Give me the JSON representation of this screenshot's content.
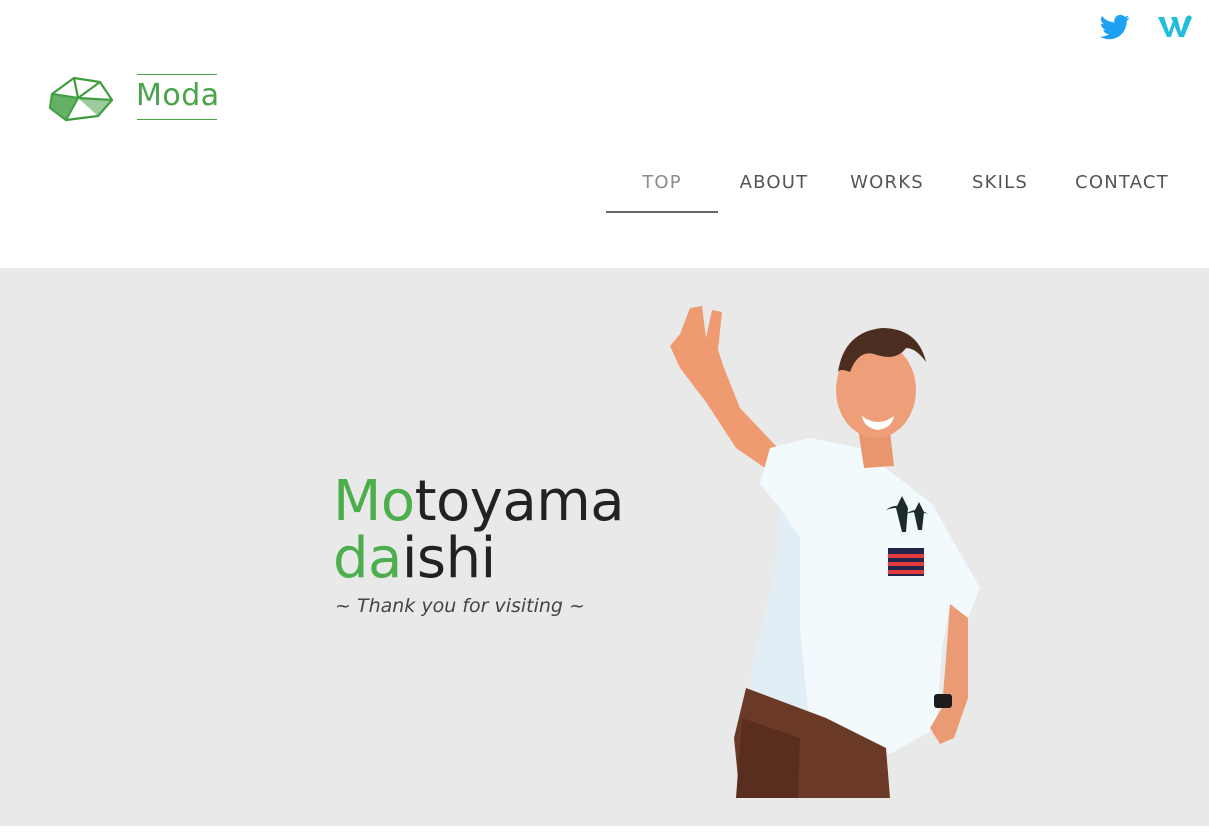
{
  "header": {
    "logo": {
      "text": "Moda"
    },
    "social": [
      {
        "name": "twitter",
        "icon": "twitter-bird-icon",
        "color": "#1da1f2"
      },
      {
        "name": "wantedly",
        "icon": "wantedly-w-icon",
        "color": "#21bddb"
      }
    ]
  },
  "nav": {
    "items": [
      {
        "label": "TOP",
        "active": true
      },
      {
        "label": "ABOUT"
      },
      {
        "label": "WORKS"
      },
      {
        "label": "SKILS"
      },
      {
        "label": "CONTACT"
      }
    ]
  },
  "hero": {
    "name_line1": {
      "accent": "Mo",
      "rest": "toyama"
    },
    "name_line2": {
      "accent": "da",
      "rest": "ishi"
    },
    "tagline": "~ Thank you for visiting ~",
    "photo": "person-peace-sign-photo"
  },
  "colors": {
    "accent": "#4cae4c",
    "hero_bg": "#e9e9e9",
    "nav_text": "#555555",
    "nav_active": "#8c8c8c"
  }
}
